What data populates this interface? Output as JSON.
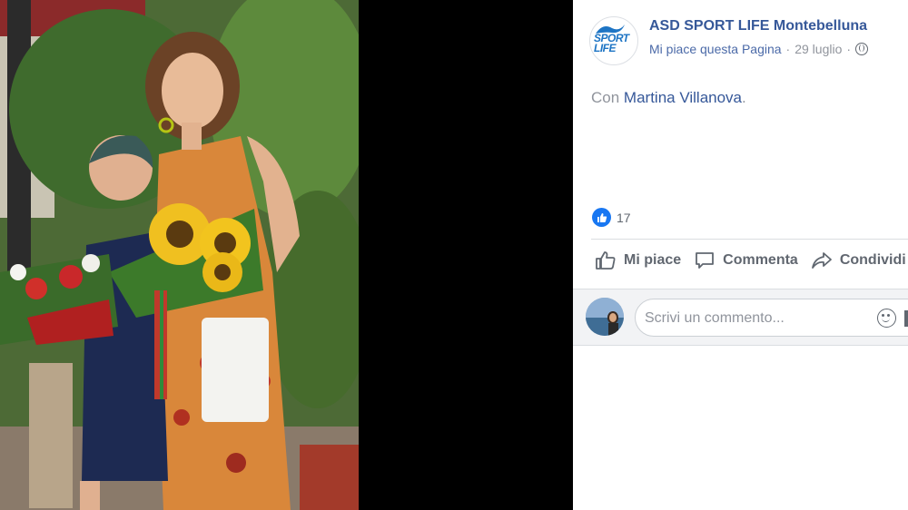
{
  "page": {
    "name": "ASD SPORT LIFE Montebelluna",
    "logo_text_line1": "SPORT",
    "logo_text_line2": "LIFE",
    "like_page_label": "Mi piace questa Pagina",
    "separator": "·",
    "date": "29 luglio"
  },
  "post": {
    "prefix": "Con ",
    "tagged_person": "Martina Villanova",
    "suffix": "."
  },
  "reactions": {
    "icon": "like-thumb-icon",
    "count": "17"
  },
  "actions": {
    "like_label": "Mi piace",
    "comment_label": "Commenta",
    "share_label": "Condividi"
  },
  "comment": {
    "placeholder": "Scrivi un commento..."
  },
  "colors": {
    "link": "#365899",
    "muted": "#90949c",
    "like_blue": "#1877f2"
  }
}
